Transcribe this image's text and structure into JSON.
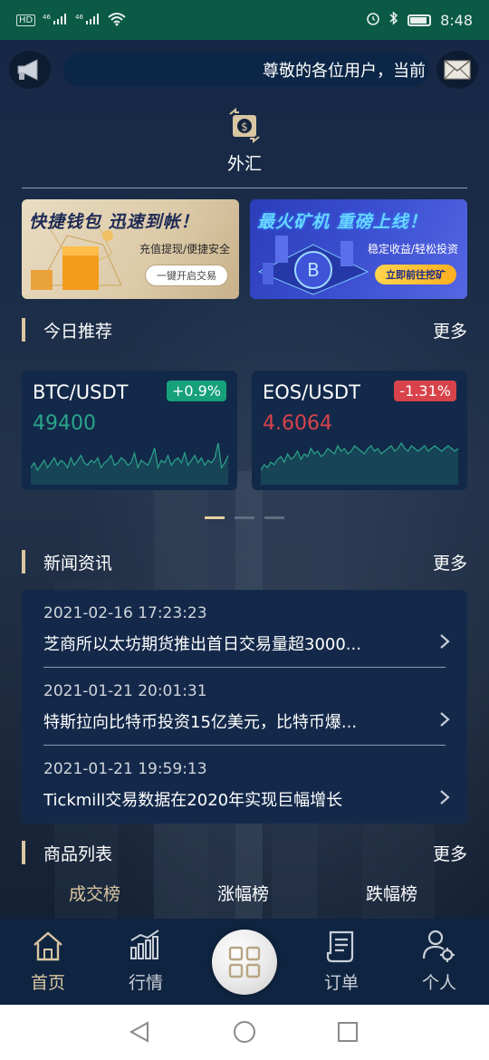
{
  "statusbar": {
    "left": [
      "HD",
      "46",
      "46"
    ],
    "time": "8:48"
  },
  "notice": {
    "text": "尊敬的各位用户，当前"
  },
  "forex": {
    "label": "外汇"
  },
  "banners": [
    {
      "title": "快捷钱包 迅速到帐！",
      "subtitle": "充值提现/便捷安全",
      "button": "一键开启交易"
    },
    {
      "title": "最火矿机 重磅上线！",
      "subtitle": "稳定收益/轻松投资",
      "button": "立即前往挖矿"
    }
  ],
  "recommend": {
    "title": "今日推荐",
    "more": "更多",
    "cards": [
      {
        "pair": "BTC/USDT",
        "change": "+0.9%",
        "price": "49400",
        "direction": "up",
        "color": "#2aa58a",
        "spark": [
          12,
          14,
          11,
          13,
          15,
          12,
          14,
          16,
          13,
          15,
          14,
          12,
          16,
          13,
          15,
          17,
          14,
          13,
          15,
          14,
          16,
          12,
          14,
          15,
          17,
          13,
          14,
          16,
          15,
          13,
          14,
          18,
          12,
          15,
          14,
          13,
          16,
          20,
          12,
          15,
          14,
          17,
          13,
          15,
          16,
          14,
          18,
          13,
          15,
          17,
          14,
          16,
          13,
          15,
          14,
          16,
          22,
          12,
          14,
          17
        ]
      },
      {
        "pair": "EOS/USDT",
        "change": "-1.31%",
        "price": "4.6064",
        "direction": "down",
        "color": "#2aa58a",
        "spark": [
          10,
          12,
          11,
          13,
          12,
          14,
          15,
          13,
          16,
          14,
          15,
          17,
          14,
          16,
          15,
          18,
          16,
          17,
          15,
          16,
          18,
          17,
          16,
          19,
          17,
          18,
          16,
          17,
          19,
          18,
          17,
          16,
          18,
          19,
          17,
          18,
          16,
          17,
          18,
          19,
          17,
          18,
          20,
          18,
          17,
          19,
          18,
          17,
          18,
          19,
          17,
          18,
          19,
          18,
          17,
          18,
          19,
          18,
          17,
          18
        ]
      }
    ],
    "pager": [
      true,
      false,
      false
    ]
  },
  "news": {
    "title": "新闻资讯",
    "more": "更多",
    "items": [
      {
        "date": "2021-02-16 17:23:23",
        "headline": "芝商所以太坊期货推出首日交易量超3000..."
      },
      {
        "date": "2021-01-21 20:01:31",
        "headline": "特斯拉向比特币投资15亿美元，比特币爆..."
      },
      {
        "date": "2021-01-21 19:59:13",
        "headline": "Tickmill交易数据在2020年实现巨幅增长"
      }
    ]
  },
  "products": {
    "title": "商品列表",
    "more": "更多",
    "tabs": [
      "成交榜",
      "涨幅榜",
      "跌幅榜"
    ],
    "active_tab": 0
  },
  "navbar": {
    "items": [
      {
        "label": "首页",
        "icon": "home-icon",
        "active": true
      },
      {
        "label": "行情",
        "icon": "market-chart-icon",
        "active": false
      },
      {
        "label": "",
        "icon": "grid-icon",
        "active": false
      },
      {
        "label": "订单",
        "icon": "order-scroll-icon",
        "active": false
      },
      {
        "label": "个人",
        "icon": "user-settings-icon",
        "active": false
      }
    ]
  },
  "colors": {
    "accent_gold": "#d9c6a2",
    "up_green": "#16a17b",
    "down_red": "#d8434b",
    "statusbar": "#0b5a45",
    "card_bg": "#13294a"
  }
}
